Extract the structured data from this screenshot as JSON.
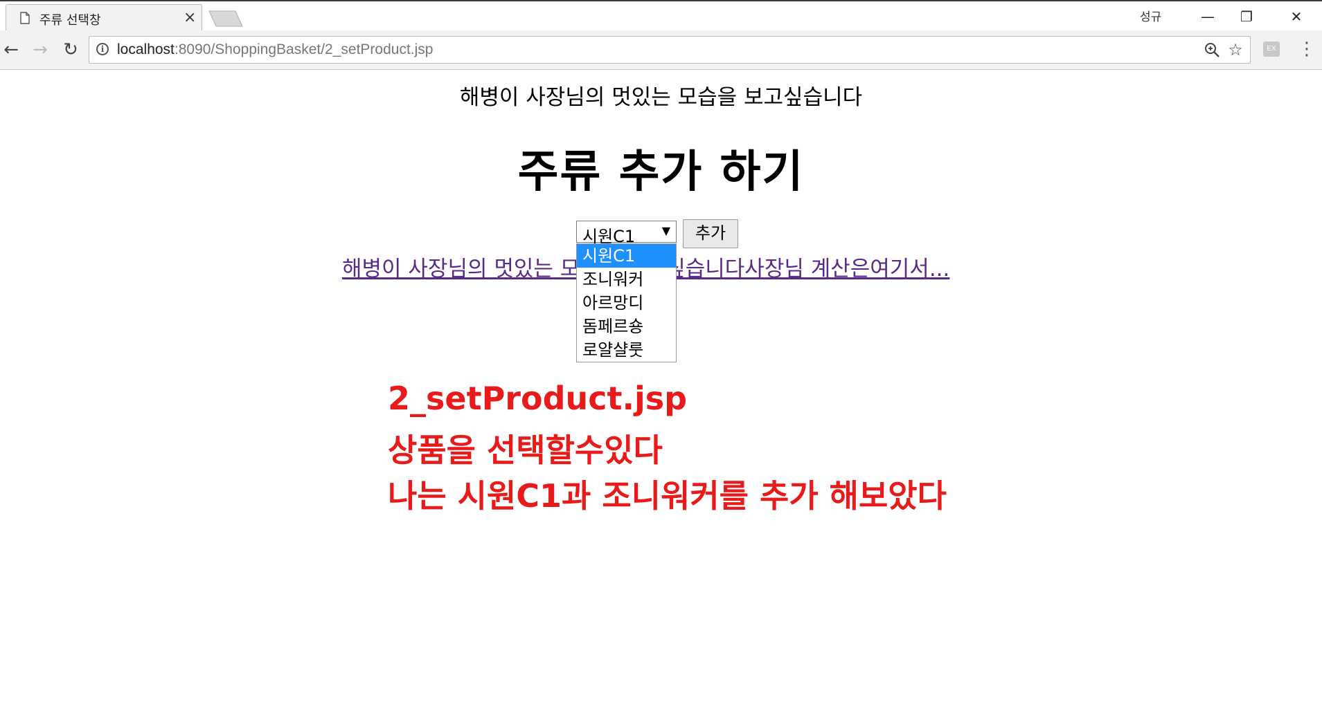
{
  "browser": {
    "tab_title": "주류 선택창",
    "tab_close": "×",
    "profile_name": "성규",
    "window_controls": {
      "minimize": "—",
      "restore": "❐",
      "close": "✕"
    },
    "url_host": "localhost",
    "url_rest": ":8090/ShoppingBasket/2_setProduct.jsp",
    "extension_label": "EX",
    "icons": [
      "doc-icon",
      "back-icon",
      "forward-icon",
      "reload-icon",
      "info-icon",
      "zoom-icon",
      "bookmark-star-icon",
      "extension-icon",
      "menu-icon"
    ]
  },
  "page": {
    "greeting": "해병이 사장님의 멋있는 모습을 보고싶습니다",
    "heading": "주류 추가 하기",
    "select": {
      "selected": "시원C1",
      "options": [
        "시원C1",
        "조니워커",
        "아르망디",
        "돔페르숑",
        "로얄샬룻"
      ]
    },
    "add_button": "추가",
    "checkout_link": "해병이 사장님의 멋있는 모습을 보고싶습니다사장님 계산은여기서..."
  },
  "annotations": [
    "2_setProduct.jsp",
    "상품을 선택할수있다",
    "나는 시원C1과 조니워커를 추가 해보았다"
  ],
  "colors": {
    "annotation": "#e81b1b",
    "link": "#5a2a88",
    "dropdown_highlight": "#1e90ff"
  }
}
